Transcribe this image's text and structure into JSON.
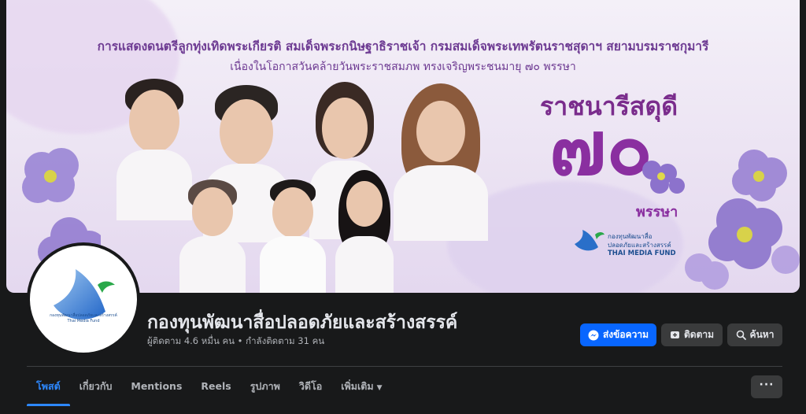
{
  "cover": {
    "title": "การแสดงดนตรีลูกทุ่งเทิดพระเกียรติ สมเด็จพระกนิษฐาธิราชเจ้า กรมสมเด็จพระเทพรัตนราชสุดาฯ สยามบรมราชกุมารี",
    "subtitle": "เนื่องในโอกาสวันคล้ายวันพระราชสมภพ ทรงเจริญพระชนมายุ ๗๐ พรรษา",
    "headline": "ราชนารีสดุดี",
    "big_number": "๗๐",
    "phansa": "พรรษา",
    "logo_thai_1": "กองทุนพัฒนาสื่อ",
    "logo_thai_2": "ปลอดภัยและสร้างสรรค์",
    "logo_en": "THAI MEDIA FUND"
  },
  "avatar": {
    "label_thai": "กองทุนพัฒนาสื่อปลอดภัยและสร้างสรรค์",
    "label_en": "Thai Media Fund"
  },
  "profile": {
    "name": "กองทุนพัฒนาสื่อปลอดภัยและสร้างสรรค์",
    "followers": "ผู้ติดตาม 4.6 หมื่น คน • กำลังติดตาม 31 คน"
  },
  "actions": {
    "message": "ส่งข้อความ",
    "follow": "ติดตาม",
    "search": "ค้นหา",
    "more": "···"
  },
  "tabs": [
    {
      "label": "โพสต์",
      "active": true
    },
    {
      "label": "เกี่ยวกับ",
      "active": false
    },
    {
      "label": "Mentions",
      "active": false
    },
    {
      "label": "Reels",
      "active": false
    },
    {
      "label": "รูปภาพ",
      "active": false
    },
    {
      "label": "วิดีโอ",
      "active": false
    },
    {
      "label": "เพิ่มเติม",
      "active": false
    }
  ],
  "colors": {
    "accent": "#0866ff",
    "active_tab": "#2d88ff",
    "background": "#18191a",
    "cover_text": "#6d3a92"
  }
}
